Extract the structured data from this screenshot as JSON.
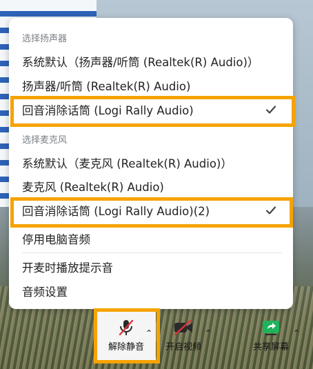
{
  "menu": {
    "speaker_section": "选择扬声器",
    "speaker_items": [
      "系统默认（扬声器/听筒 (Realtek(R) Audio)）",
      "扬声器/听筒 (Realtek(R) Audio)",
      "回音消除话筒 (Logi Rally Audio)"
    ],
    "mic_section": "选择麦克风",
    "mic_items": [
      "系统默认（麦克风 (Realtek(R) Audio)）",
      "麦克风 (Realtek(R) Audio)",
      "回音消除话筒 (Logi Rally Audio)(2)"
    ],
    "stop_audio": "停用电脑音频",
    "play_tone": "开麦时播放提示音",
    "audio_settings": "音频设置"
  },
  "toolbar": {
    "unmute": "解除静音",
    "start_video": "开启视频",
    "share_screen": "共享屏幕"
  },
  "colors": {
    "highlight": "#f5a300",
    "muted_red": "#e0343a",
    "share_green": "#1fb35b"
  },
  "icons": [
    "check-icon",
    "microphone-muted-icon",
    "video-off-icon",
    "share-screen-icon",
    "chevron-up-icon"
  ]
}
